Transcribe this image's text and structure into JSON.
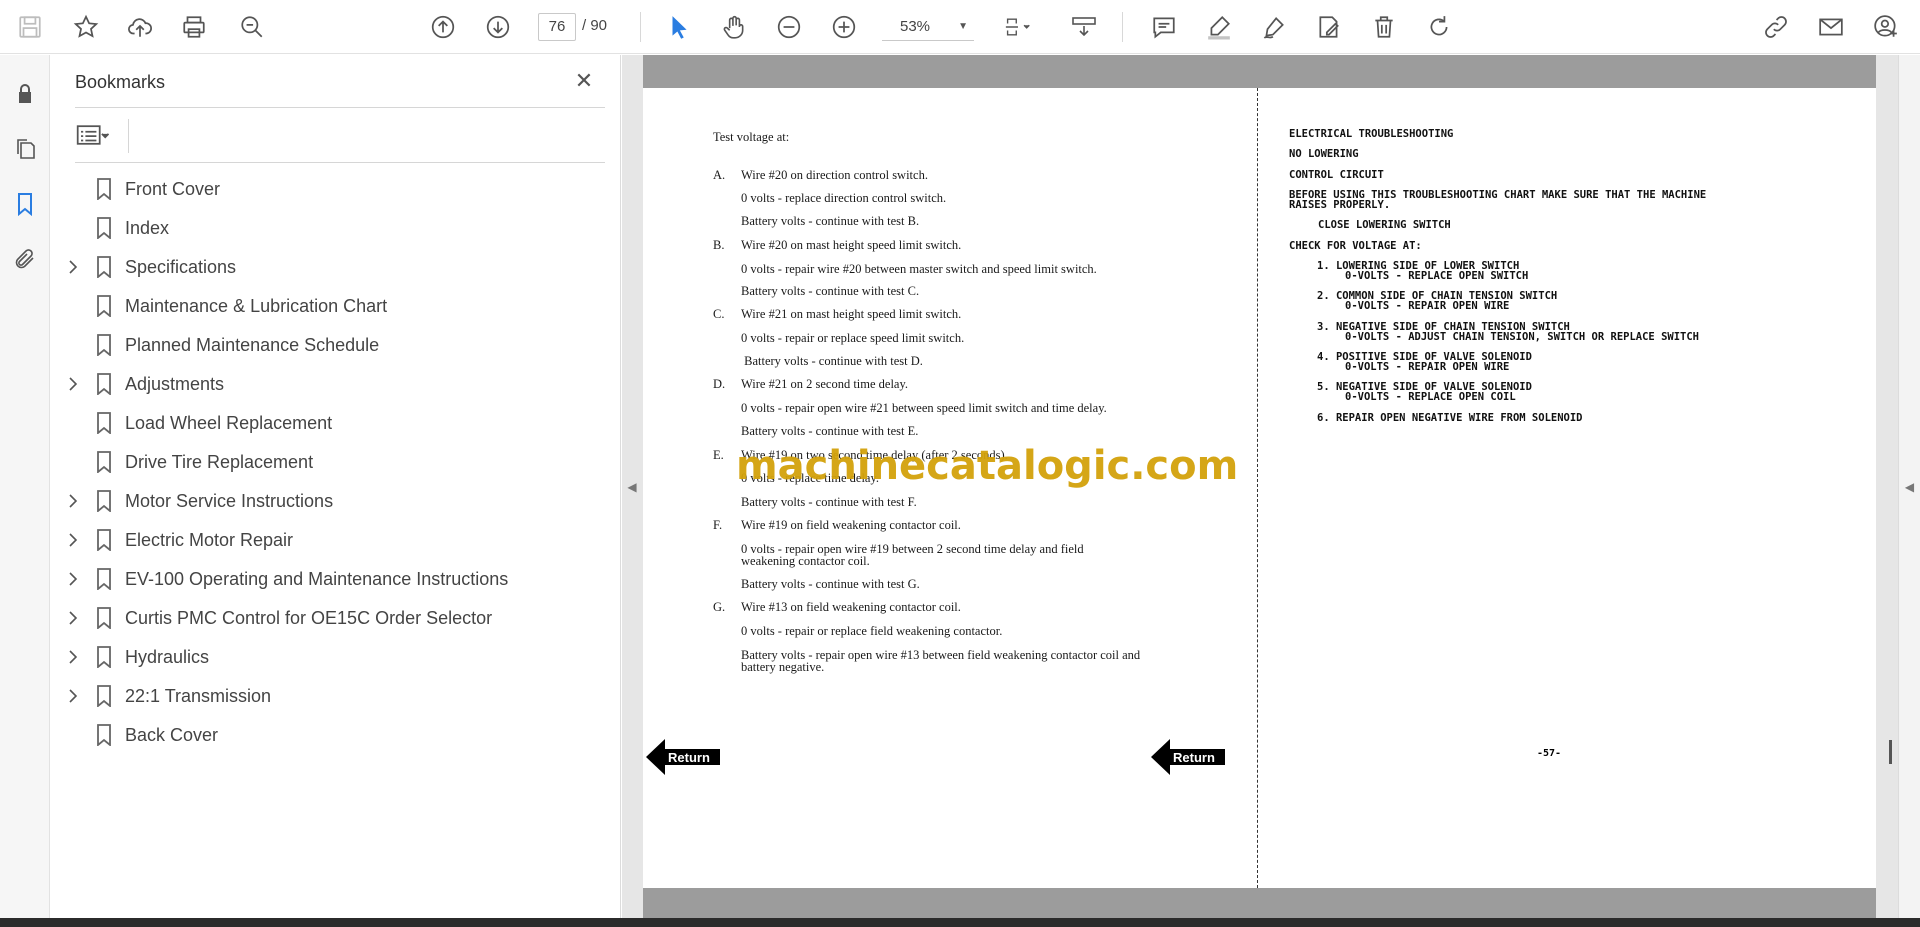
{
  "toolbar": {
    "page_current": "76",
    "page_total": "/  90",
    "zoom": "53%",
    "icons": [
      "save-icon",
      "star-icon",
      "upload-icon",
      "print-icon",
      "find-icon",
      "page-up-icon",
      "page-down-icon",
      "select-cursor-icon",
      "hand-icon",
      "zoom-out-icon",
      "zoom-in-icon",
      "fit-page-icon",
      "scroll-mode-icon",
      "comment-icon",
      "highlight-icon",
      "sign-icon",
      "fill-sign-icon",
      "delete-icon",
      "rotate-icon",
      "share-link-icon",
      "mail-icon",
      "account-icon"
    ]
  },
  "rail": {
    "icons": [
      "lock-icon",
      "pages-icon",
      "bookmark-icon",
      "attachment-icon"
    ]
  },
  "bookmarks": {
    "title": "Bookmarks",
    "items": [
      {
        "label": "Front Cover",
        "expandable": false
      },
      {
        "label": "Index",
        "expandable": false
      },
      {
        "label": "Specifications",
        "expandable": true
      },
      {
        "label": "Maintenance & Lubrication Chart",
        "expandable": false
      },
      {
        "label": "Planned Maintenance Schedule",
        "expandable": false
      },
      {
        "label": "Adjustments",
        "expandable": true
      },
      {
        "label": "Load Wheel Replacement",
        "expandable": false
      },
      {
        "label": "Drive Tire Replacement",
        "expandable": false
      },
      {
        "label": "Motor Service Instructions",
        "expandable": true
      },
      {
        "label": "Electric Motor Repair",
        "expandable": true
      },
      {
        "label": "EV-100 Operating and Maintenance Instructions",
        "expandable": true
      },
      {
        "label": "Curtis PMC Control for OE15C Order Selector",
        "expandable": true
      },
      {
        "label": "Hydraulics",
        "expandable": true
      },
      {
        "label": "22:1 Transmission",
        "expandable": true
      },
      {
        "label": "Back Cover",
        "expandable": false
      }
    ]
  },
  "left_page": {
    "heading": "Test voltage at:",
    "lines": [
      {
        "letter": "A.",
        "text": "Wire #20 on direction control switch."
      },
      {
        "letter": "",
        "text": "0 volts - replace direction control switch."
      },
      {
        "letter": "",
        "text": "Battery volts - continue with test B."
      },
      {
        "letter": "B.",
        "text": "Wire #20 on mast height speed limit switch."
      },
      {
        "letter": "",
        "text": "0 volts - repair wire #20 between master switch and speed limit switch."
      },
      {
        "letter": "",
        "text": "Battery volts - continue with test C."
      },
      {
        "letter": "C.",
        "text": "Wire #21 on mast height speed limit switch."
      },
      {
        "letter": "",
        "text": "0 volts - repair or replace speed limit switch."
      },
      {
        "letter": "",
        "text": " Battery volts - continue with test D."
      },
      {
        "letter": "D.",
        "text": "Wire #21 on 2 second time delay."
      },
      {
        "letter": "",
        "text": "0 volts - repair open wire #21 between speed limit switch and time delay."
      },
      {
        "letter": "",
        "text": "Battery volts - continue with test E."
      },
      {
        "letter": "E.",
        "text": "Wire #19 on two second time delay (after 2 seconds)."
      },
      {
        "letter": "",
        "text": "0 volts - replace time delay."
      },
      {
        "letter": "",
        "text": "Battery volts - continue with test F."
      },
      {
        "letter": "F.",
        "text": "Wire #19 on field weakening contactor coil."
      },
      {
        "letter": "",
        "text": "0 volts - repair open wire #19 between 2 second time delay and field"
      },
      {
        "letter": "",
        "text": "weakening contactor coil."
      },
      {
        "letter": "",
        "text": "Battery volts - continue with test G."
      },
      {
        "letter": "G.",
        "text": "Wire #13 on field weakening contactor coil."
      },
      {
        "letter": "",
        "text": "0 volts - repair or replace field weakening contactor."
      },
      {
        "letter": "",
        "text": "Battery volts - repair open wire #13 between field weakening contactor coil and"
      },
      {
        "letter": "",
        "text": "battery negative."
      }
    ],
    "watermark": "machinecatalogic.com",
    "return_label": "Return"
  },
  "right_page": {
    "lines": [
      "ELECTRICAL TROUBLESHOOTING",
      "NO LOWERING",
      "CONTROL CIRCUIT",
      "BEFORE USING THIS TROUBLESHOOTING CHART MAKE SURE THAT THE MACHINE",
      "RAISES PROPERLY.",
      "CLOSE LOWERING SWITCH",
      "CHECK FOR VOLTAGE AT:",
      "1. LOWERING SIDE OF LOWER SWITCH",
      "0-VOLTS - REPLACE OPEN SWITCH",
      "2. COMMON SIDE OF CHAIN TENSION SWITCH",
      "0-VOLTS - REPAIR OPEN WIRE",
      "3. NEGATIVE SIDE OF CHAIN TENSION SWITCH",
      "0-VOLTS - ADJUST CHAIN TENSION, SWITCH OR REPLACE SWITCH",
      "4. POSITIVE SIDE OF VALVE SOLENOID",
      "0-VOLTS - REPAIR OPEN WIRE",
      "5. NEGATIVE SIDE OF VALVE SOLENOID",
      "0-VOLTS - REPLACE OPEN COIL",
      "6. REPAIR OPEN NEGATIVE WIRE FROM SOLENOID"
    ],
    "page_number": "-57-",
    "return_label": "Return"
  },
  "colors": {
    "accent": "#2a7de1",
    "watermark": "#d3a20b"
  }
}
